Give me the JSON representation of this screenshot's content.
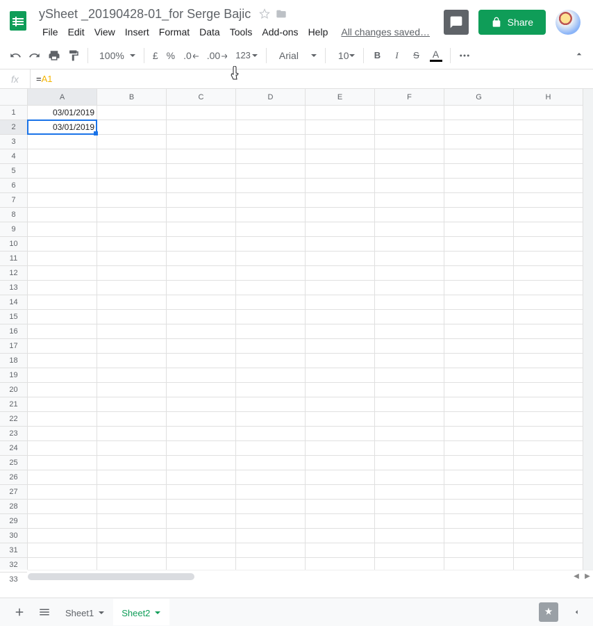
{
  "doc": {
    "title": "ySheet _20190428-01_for Serge Bajic"
  },
  "menus": [
    "File",
    "Edit",
    "View",
    "Insert",
    "Format",
    "Data",
    "Tools",
    "Add-ons",
    "Help"
  ],
  "saved_text": "All changes saved…",
  "share_label": "Share",
  "toolbar": {
    "zoom": "100%",
    "currency": "£",
    "percent": "%",
    "dec_dec": ".0",
    "dec_inc": ".00",
    "fmt_num": "123",
    "font": "Arial",
    "size": "10",
    "bold": "B",
    "italic": "I",
    "strike": "S",
    "text_color": "A"
  },
  "formula": {
    "fx": "fx",
    "eq": "=",
    "ref": "A1"
  },
  "columns": [
    "A",
    "B",
    "C",
    "D",
    "E",
    "F",
    "G",
    "H"
  ],
  "selected_col": 0,
  "rows": 33,
  "selected_row": 2,
  "cells": {
    "A1": "03/01/2019",
    "A2": "03/01/2019"
  },
  "tabs": [
    {
      "label": "Sheet1",
      "active": false
    },
    {
      "label": "Sheet2",
      "active": true
    }
  ]
}
